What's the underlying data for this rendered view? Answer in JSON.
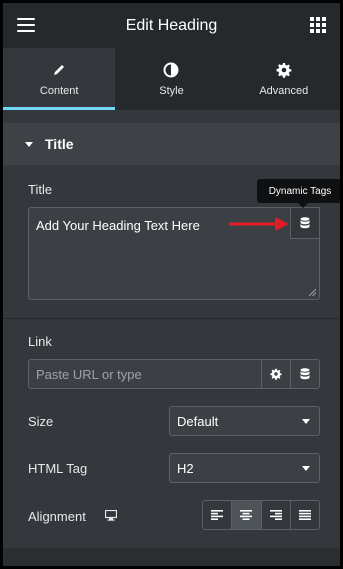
{
  "header": {
    "title": "Edit Heading"
  },
  "tabs": [
    {
      "label": "Content",
      "icon": "pencil-icon",
      "active": true
    },
    {
      "label": "Style",
      "icon": "half-circle-icon",
      "active": false
    },
    {
      "label": "Advanced",
      "icon": "gear-icon",
      "active": false
    }
  ],
  "section": {
    "label": "Title"
  },
  "title_control": {
    "label": "Title",
    "value": "Add Your Heading Text Here",
    "tooltip": "Dynamic Tags"
  },
  "link_control": {
    "label": "Link",
    "placeholder": "Paste URL or type"
  },
  "size_control": {
    "label": "Size",
    "value": "Default"
  },
  "html_tag_control": {
    "label": "HTML Tag",
    "value": "H2"
  },
  "alignment_control": {
    "label": "Alignment",
    "options": [
      "left",
      "center",
      "right",
      "justify"
    ],
    "selected": "center"
  },
  "colors": {
    "panel": "#34383c",
    "header": "#26292c",
    "accent": "#71d7f7",
    "annotation_arrow": "#e31b23"
  }
}
